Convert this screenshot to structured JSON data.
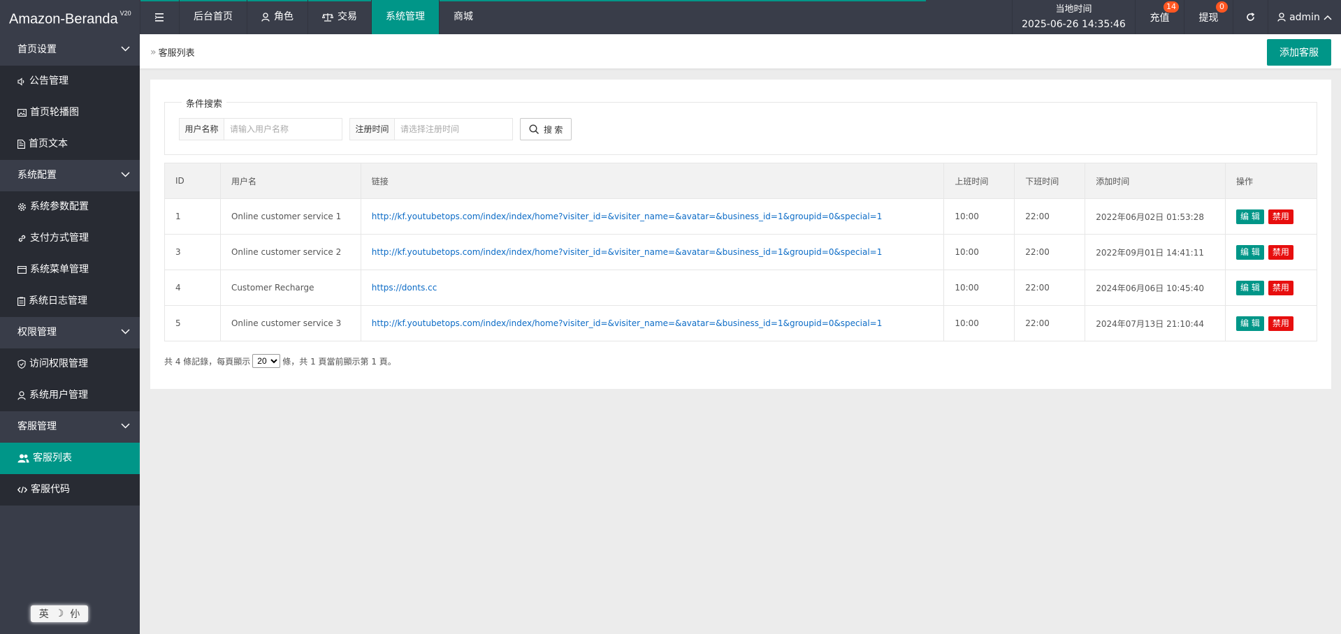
{
  "app": {
    "name": "Amazon-Beranda",
    "version": "V20"
  },
  "topnav": {
    "items": [
      {
        "label": "后台首页"
      },
      {
        "label": "角色"
      },
      {
        "label": "交易"
      },
      {
        "label": "系统管理"
      },
      {
        "label": "商城"
      }
    ]
  },
  "topright": {
    "time_label": "当地时间",
    "time_value": "2025-06-26 14:35:46",
    "recharge_label": "充值",
    "recharge_count": "14",
    "withdraw_label": "提现",
    "withdraw_count": "0",
    "user": "admin"
  },
  "sidebar": {
    "groups": [
      {
        "label": "首页设置",
        "items": [
          {
            "label": "公告管理"
          },
          {
            "label": "首页轮播图"
          },
          {
            "label": "首页文本"
          }
        ]
      },
      {
        "label": "系统配置",
        "items": [
          {
            "label": "系统参数配置"
          },
          {
            "label": "支付方式管理"
          },
          {
            "label": "系统菜单管理"
          },
          {
            "label": "系统日志管理"
          }
        ]
      },
      {
        "label": "权限管理",
        "items": [
          {
            "label": "访问权限管理"
          },
          {
            "label": "系统用户管理"
          }
        ]
      },
      {
        "label": "客服管理",
        "items": [
          {
            "label": "客服列表"
          },
          {
            "label": "客服代码"
          }
        ]
      }
    ],
    "ime": {
      "lang": "英",
      "moon": "☽",
      "mode": "仦"
    }
  },
  "breadcrumb": {
    "sep": "»",
    "current": "客服列表"
  },
  "add_button": "添加客服",
  "search": {
    "legend": "条件搜索",
    "username_label": "用户名称",
    "username_placeholder": "请输入用户名称",
    "regtime_label": "注册时间",
    "regtime_placeholder": "请选择注册时间",
    "button": "搜 索"
  },
  "table": {
    "headers": [
      "ID",
      "用户名",
      "链接",
      "上班时间",
      "下班时间",
      "添加时间",
      "操作"
    ],
    "rows": [
      {
        "id": "1",
        "name": "Online customer service 1",
        "link": "http://kf.youtubetops.com/index/index/home?visiter_id=&visiter_name=&avatar=&business_id=1&groupid=0&special=1",
        "start": "10:00",
        "end": "22:00",
        "added": "2022年06月02日 01:53:28"
      },
      {
        "id": "3",
        "name": "Online customer service 2",
        "link": "http://kf.youtubetops.com/index/index/home?visiter_id=&visiter_name=&avatar=&business_id=1&groupid=0&special=1",
        "start": "10:00",
        "end": "22:00",
        "added": "2022年09月01日 14:41:11"
      },
      {
        "id": "4",
        "name": "Customer Recharge",
        "link": "https://donts.cc",
        "start": "10:00",
        "end": "22:00",
        "added": "2024年06月06日 10:45:40"
      },
      {
        "id": "5",
        "name": "Online customer service 3",
        "link": "http://kf.youtubetops.com/index/index/home?visiter_id=&visiter_name=&avatar=&business_id=1&groupid=0&special=1",
        "start": "10:00",
        "end": "22:00",
        "added": "2024年07月13日 21:10:44"
      }
    ],
    "edit_label": "编 辑",
    "ban_label": "禁用"
  },
  "pager": {
    "prefix": "共 4 條記錄，每頁顯示",
    "page_size": "20",
    "suffix": "條，共 1 頁當前顯示第 1 頁。"
  },
  "colors": {
    "accent": "#009688",
    "dark": "#393d49",
    "danger": "#e70e0e",
    "badge": "#ff5722"
  },
  "icons": {
    "menu_toggle": "menu-icon",
    "role": "user-icon",
    "trade": "scale-icon",
    "refresh": "refresh-icon",
    "announce": "speaker-icon",
    "carousel": "image-icon",
    "text": "document-icon",
    "params": "gear-icon",
    "payment": "link-icon",
    "menu_mgmt": "window-icon",
    "log": "clipboard-icon",
    "access": "shield-icon",
    "sysuser": "user-icon",
    "cs_list": "users-icon",
    "cs_code": "code-icon",
    "search": "search-icon"
  }
}
